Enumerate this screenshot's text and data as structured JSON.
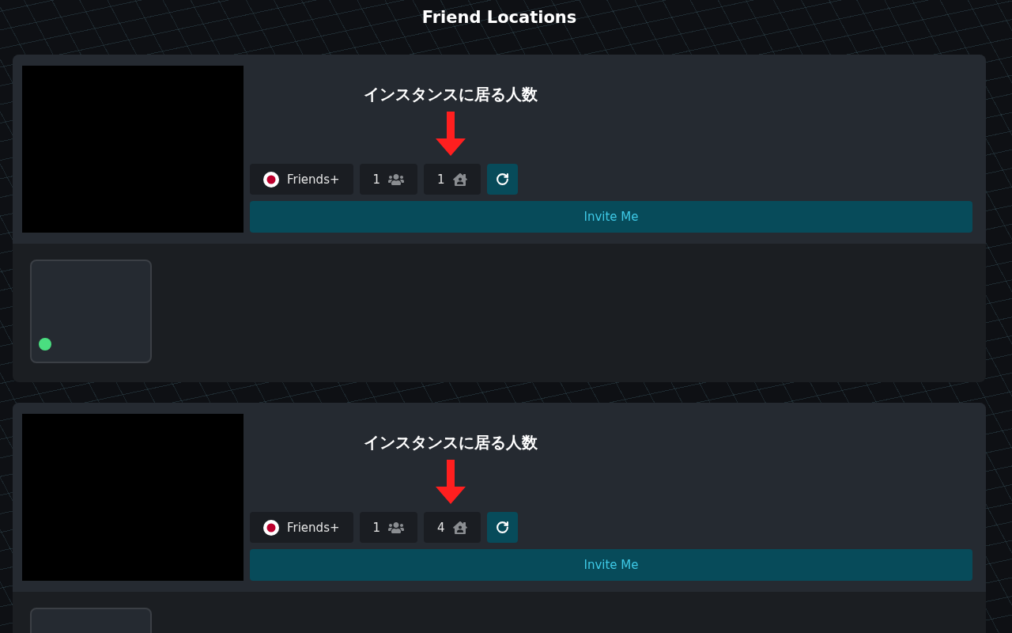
{
  "title": "Friend Locations",
  "instances": [
    {
      "annotation": "インスタンスに居る人数",
      "access": "Friends+",
      "friend_count": "1",
      "user_count": "1",
      "invite": "Invite Me",
      "friends": [
        {
          "kind": "friend",
          "color": "#4ade80"
        }
      ]
    },
    {
      "annotation": "インスタンスに居る人数",
      "access": "Friends+",
      "friend_count": "1",
      "user_count": "4",
      "invite": "Invite Me",
      "friends": [
        {
          "kind": "friend"
        }
      ]
    }
  ]
}
